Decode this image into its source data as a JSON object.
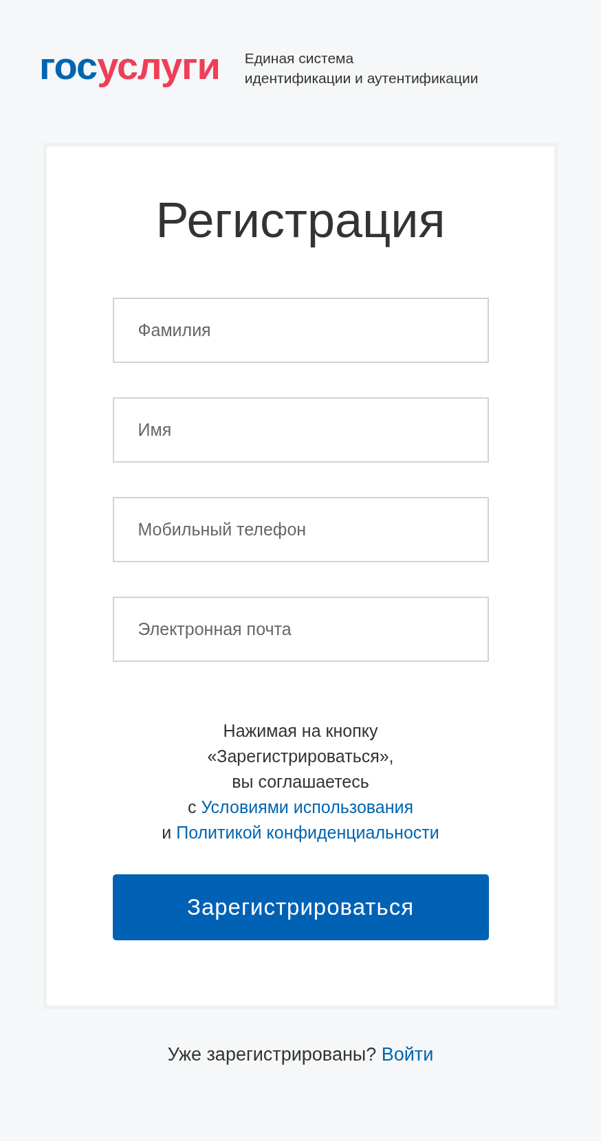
{
  "header": {
    "logo": {
      "part_1": "гос",
      "part_2": "услуги"
    },
    "tagline": [
      "Единая система",
      "идентификации и аутентификации"
    ]
  },
  "form": {
    "title": "Регистрация",
    "fields": [
      {
        "placeholder": "Фамилия"
      },
      {
        "placeholder": "Имя"
      },
      {
        "placeholder": "Мобильный телефон"
      },
      {
        "placeholder": "Электронная почта"
      }
    ],
    "consent": [
      {
        "text": "Нажимая на кнопку"
      },
      {
        "text": "«Зарегистрироваться»,"
      },
      {
        "text": "вы соглашаетесь"
      },
      {
        "text": "с",
        "link": "Условиями использования"
      },
      {
        "text": "и",
        "link": "Политикой конфиденциальности"
      }
    ],
    "submit": "Зарегистрироваться"
  },
  "footer": {
    "text": "Уже зарегистрированы?",
    "link": "Войти"
  }
}
